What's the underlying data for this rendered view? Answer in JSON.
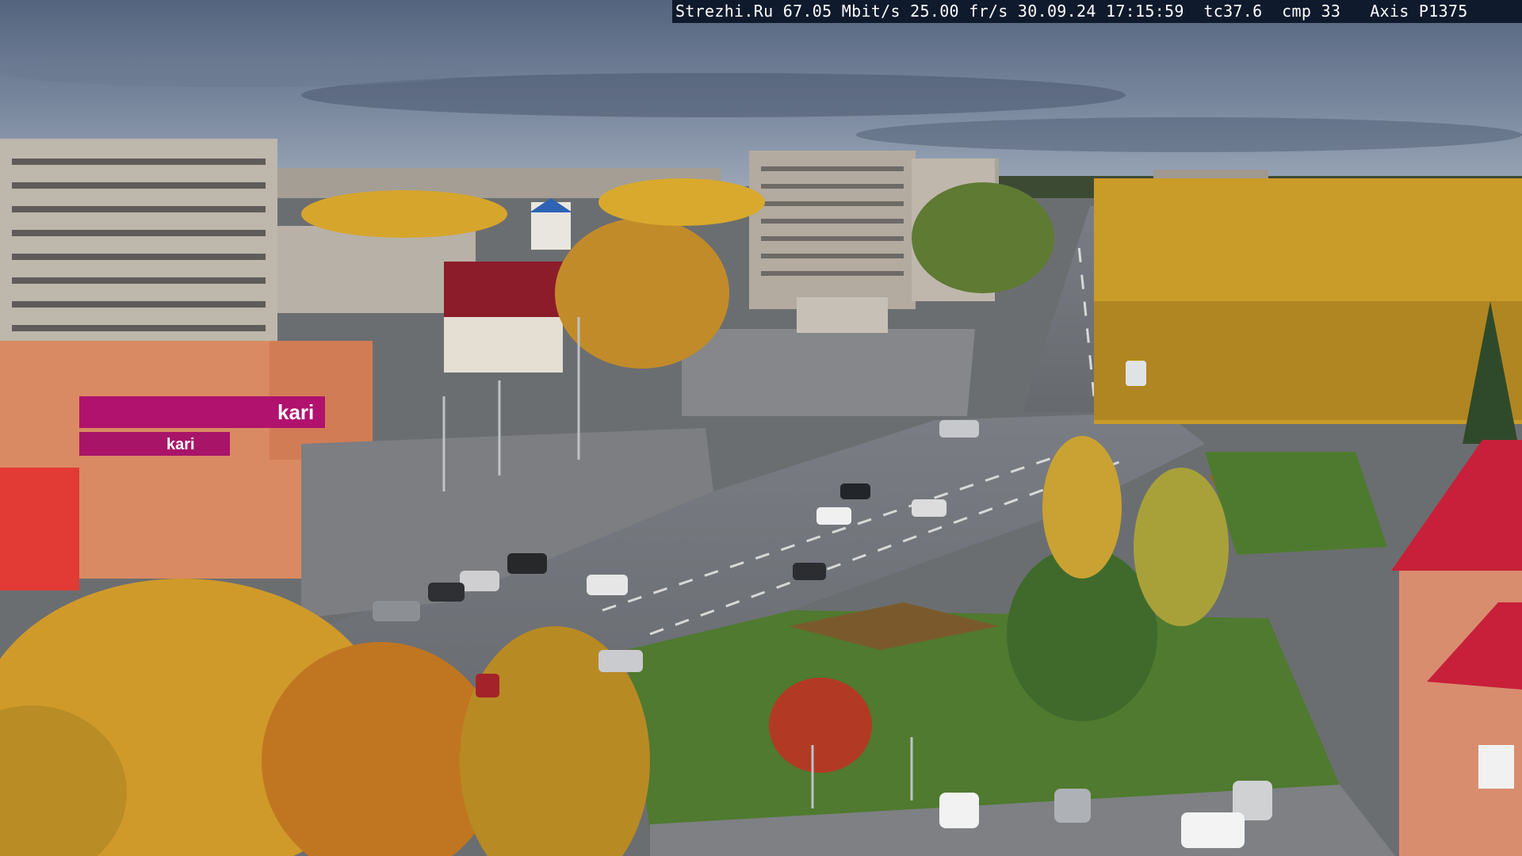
{
  "overlay": {
    "text": "Strezhi.Ru 67.05 Mbit/s 25.00 fr/s 30.09.24 17:15:59  tc37.6  cmp 33   Axis P1375"
  },
  "storefront": {
    "sign_brand": "kari",
    "sign_front": "kari"
  },
  "colors": {
    "sky_top": "#54647e",
    "sky_bottom": "#8d9bb0",
    "asphalt": "#6f7277",
    "grass": "#4f7a2f",
    "foliage_yellow": "#d9a72a",
    "foliage_orange": "#c9761f",
    "kari_magenta": "#b0126e",
    "roof_red": "#b5172b",
    "building_panel": "#bdb7ac"
  }
}
